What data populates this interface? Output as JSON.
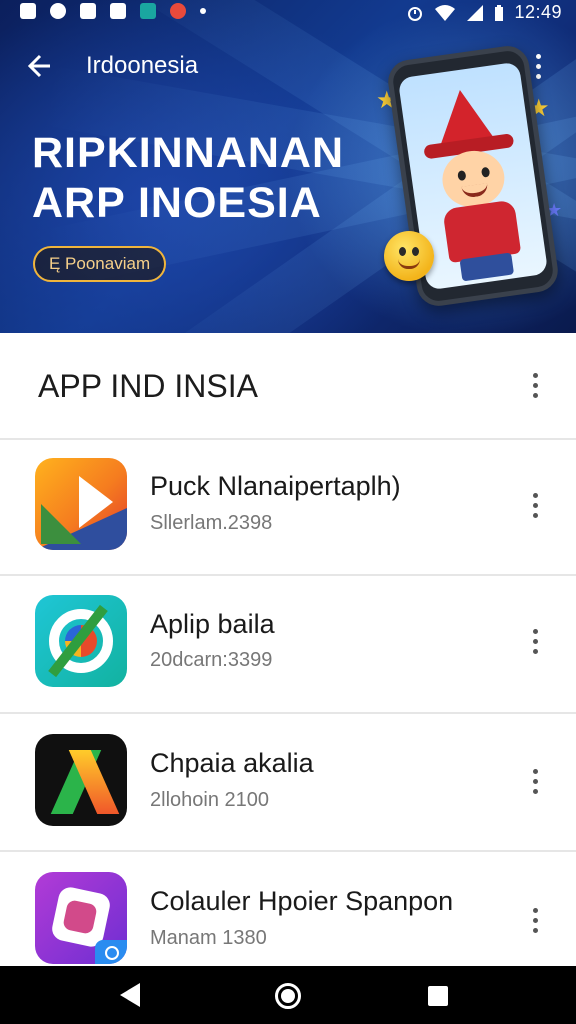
{
  "status_bar": {
    "time": "12:49",
    "icons": [
      "gallery-icon",
      "location-icon",
      "camera-icon",
      "file-icon",
      "teal-app-icon",
      "red-app-icon",
      "notification-dot-icon",
      "alarm-icon",
      "wifi-icon",
      "signal-icon",
      "battery-icon"
    ]
  },
  "toolbar": {
    "title": "Irdoonesia",
    "back_icon": "back-arrow-icon",
    "more_icon": "more-vert-icon"
  },
  "hero": {
    "title_line1": "RIPKINNANAN",
    "title_line2": "ARP INOESIA",
    "promo_label": "Ę Poonaviam"
  },
  "section": {
    "title": "APP IND INSIA",
    "more_icon": "more-vert-icon"
  },
  "apps": [
    {
      "name": "Puck Nlanaipertaplh)",
      "meta": "Sllerlam.2398",
      "icon": "orange-red-triangle-app-icon"
    },
    {
      "name": "Aplip baila",
      "meta": "20dcarn:3399",
      "icon": "teal-compass-app-icon"
    },
    {
      "name": "Chpaia akalia",
      "meta": "2llohoin 2100",
      "icon": "black-a-letter-app-icon"
    },
    {
      "name": "Colauler Hpoier Spanpon",
      "meta": "Manam 1380",
      "icon": "purple-shape-app-icon"
    }
  ],
  "nav_bar": {
    "back": "nav-back-icon",
    "home": "nav-home-icon",
    "recents": "nav-recents-icon"
  },
  "colors": {
    "hero_bg": "#0f2a74",
    "accent_gold": "#f0b53c",
    "divider": "#e6e6e6"
  }
}
